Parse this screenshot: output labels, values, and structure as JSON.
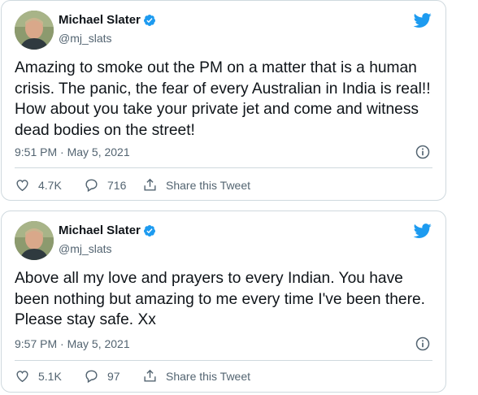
{
  "tweets": [
    {
      "author": {
        "name": "Michael Slater",
        "handle": "@mj_slats"
      },
      "text": "Amazing to smoke out the PM on a matter that is a human crisis. The panic, the fear of every Australian in India is real!! How about you take your private jet and come and witness dead bodies on the street!",
      "timestamp": "9:51 PM · May 5, 2021",
      "likes": "4.7K",
      "replies": "716",
      "share_label": "Share this Tweet"
    },
    {
      "author": {
        "name": "Michael Slater",
        "handle": "@mj_slats"
      },
      "text": "Above all my love and prayers to every Indian. You have been nothing but amazing to me every time I've been there. Please stay safe. Xx",
      "timestamp": "9:57 PM · May 5, 2021",
      "likes": "5.1K",
      "replies": "97",
      "share_label": "Share this Tweet"
    }
  ],
  "icons": {
    "verified": "verified-badge-icon",
    "brand": "twitter-bird-icon",
    "info": "info-icon",
    "like": "heart-icon",
    "reply": "reply-bubble-icon",
    "share": "share-icon"
  },
  "colors": {
    "brand_blue": "#1d9bf0",
    "text_primary": "#0f1419",
    "text_secondary": "#536471",
    "border": "#cfd9de"
  }
}
